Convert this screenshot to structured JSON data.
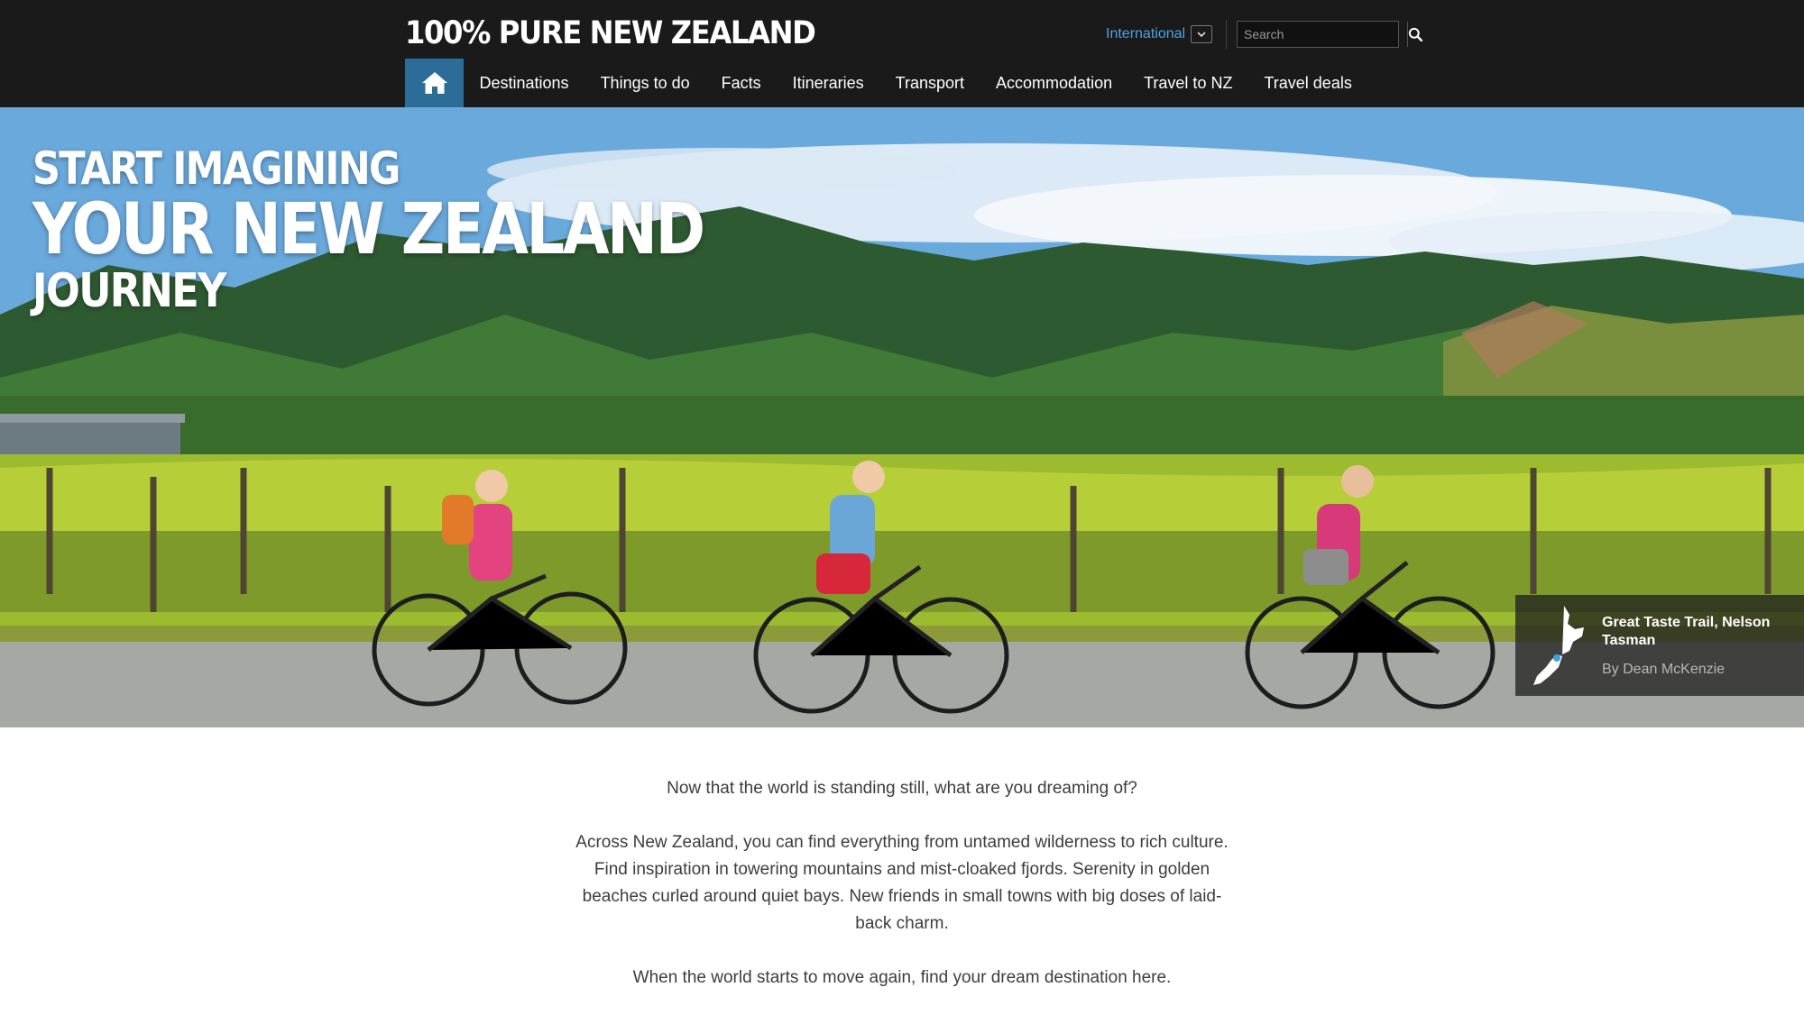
{
  "header": {
    "logo": "100% PURE NEW ZEALAND",
    "region": {
      "label": "International"
    },
    "search": {
      "placeholder": "Search"
    }
  },
  "nav": {
    "home_icon": "home-icon",
    "items": [
      {
        "label": "Destinations"
      },
      {
        "label": "Things to do"
      },
      {
        "label": "Facts"
      },
      {
        "label": "Itineraries"
      },
      {
        "label": "Transport"
      },
      {
        "label": "Accommodation"
      },
      {
        "label": "Travel to NZ"
      },
      {
        "label": "Travel deals"
      }
    ]
  },
  "hero": {
    "line1": "START IMAGINING",
    "line2": "YOUR NEW ZEALAND",
    "line3": "JOURNEY",
    "caption": {
      "title": "Great Taste Trail, Nelson Tasman",
      "credit": "By Dean McKenzie",
      "icon": "nz-map-icon"
    }
  },
  "content": {
    "paragraphs": [
      "Now that the world is standing still, what are you dreaming of?",
      "Across New Zealand, you can find everything from untamed wilderness to rich culture. Find inspiration in towering mountains and mist-cloaked fjords. Serenity in golden beaches curled around quiet bays. New friends in small towns with big doses of laid-back charm.",
      "When the world starts to move again, find your dream destination here."
    ]
  },
  "colors": {
    "header_bg": "#1a1a1a",
    "home_accent": "#2b6d98",
    "region_link": "#4ea3e6",
    "body_text": "#3d3d3d"
  }
}
